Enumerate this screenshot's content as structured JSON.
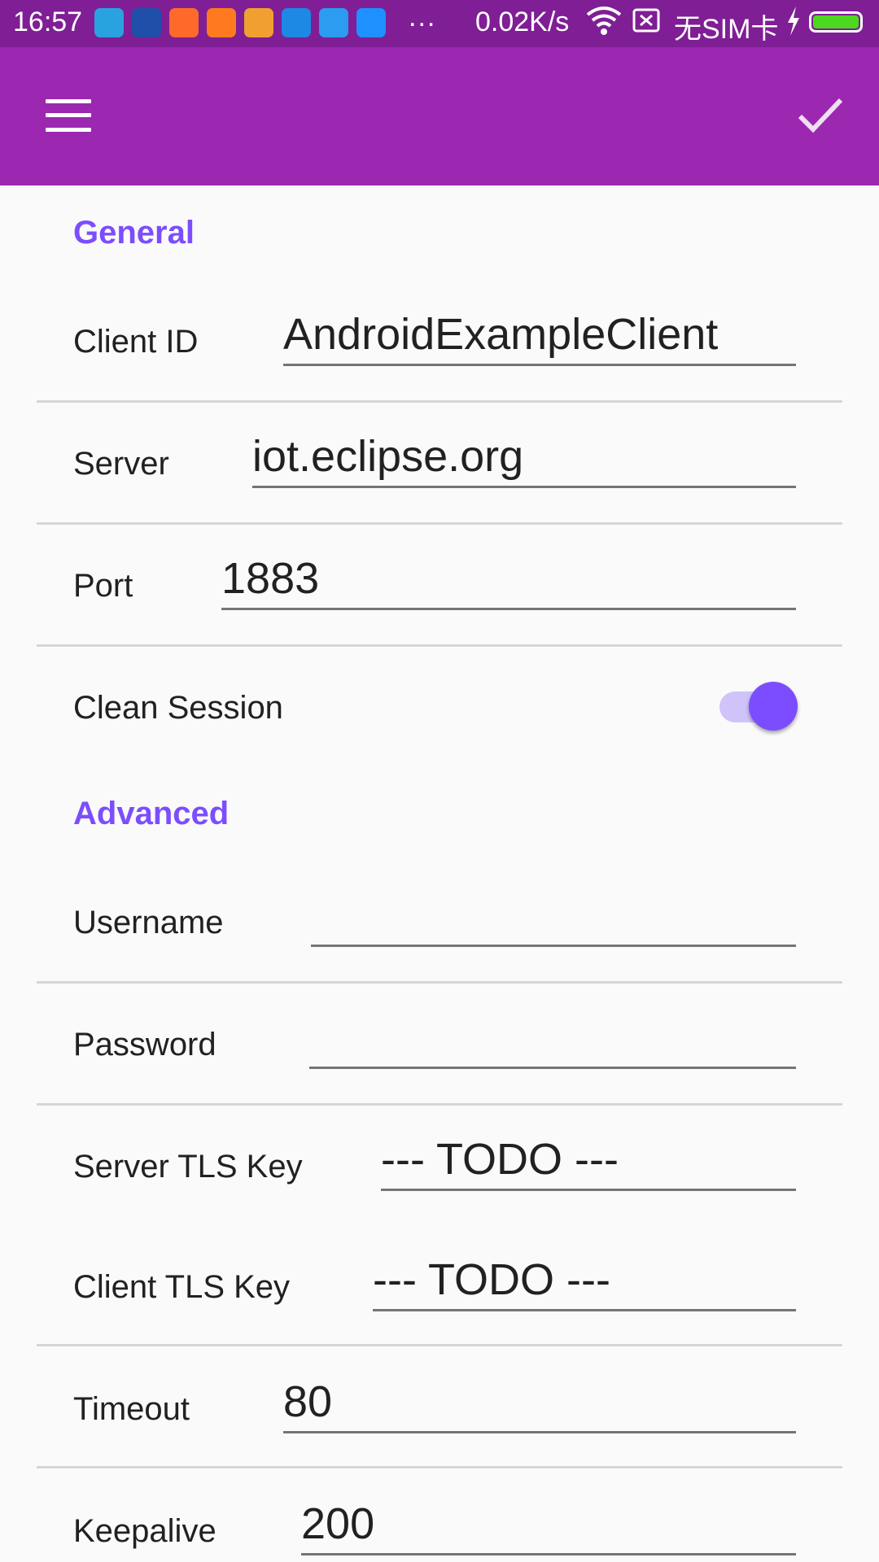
{
  "status_bar": {
    "time": "16:57",
    "more_indicator": "...",
    "network_speed": "0.02K/s",
    "sim_status": "无SIM卡",
    "wifi_icon": "wifi-icon",
    "charging_icon": "bolt-icon",
    "battery_color": "#4cd81e",
    "app_icons": [
      {
        "name": "usb-icon",
        "color": "#29a3e0"
      },
      {
        "name": "news-app-icon",
        "color": "#1f4fa8"
      },
      {
        "name": "shop-app-icon",
        "color": "#ff6a2b"
      },
      {
        "name": "book-app-icon",
        "color": "#ff7a1f"
      },
      {
        "name": "kite-app-icon",
        "color": "#f0a030"
      },
      {
        "name": "pay-app-icon",
        "color": "#1e88e5"
      },
      {
        "name": "send-app-icon",
        "color": "#2b9cf0"
      },
      {
        "name": "chat-app-icon",
        "color": "#1e90ff"
      }
    ]
  },
  "app_bar": {
    "color": "#9c27b0",
    "status_color": "#7f1e95",
    "menu_icon": "menu-icon",
    "confirm_icon": "check-icon"
  },
  "accent_color": "#7c4dff",
  "sections": {
    "general": "General",
    "advanced": "Advanced"
  },
  "fields": {
    "client_id": {
      "label": "Client ID",
      "value": "AndroidExampleClient"
    },
    "server": {
      "label": "Server",
      "value": "iot.eclipse.org"
    },
    "port": {
      "label": "Port",
      "value": "1883"
    },
    "clean_session": {
      "label": "Clean Session",
      "enabled": true
    },
    "username": {
      "label": "Username",
      "value": ""
    },
    "password": {
      "label": "Password",
      "value": ""
    },
    "server_tls_key": {
      "label": "Server TLS Key",
      "value": "--- TODO ---"
    },
    "client_tls_key": {
      "label": "Client TLS Key",
      "value": "--- TODO ---"
    },
    "timeout": {
      "label": "Timeout",
      "value": "80"
    },
    "keepalive": {
      "label": "Keepalive",
      "value": "200"
    }
  }
}
